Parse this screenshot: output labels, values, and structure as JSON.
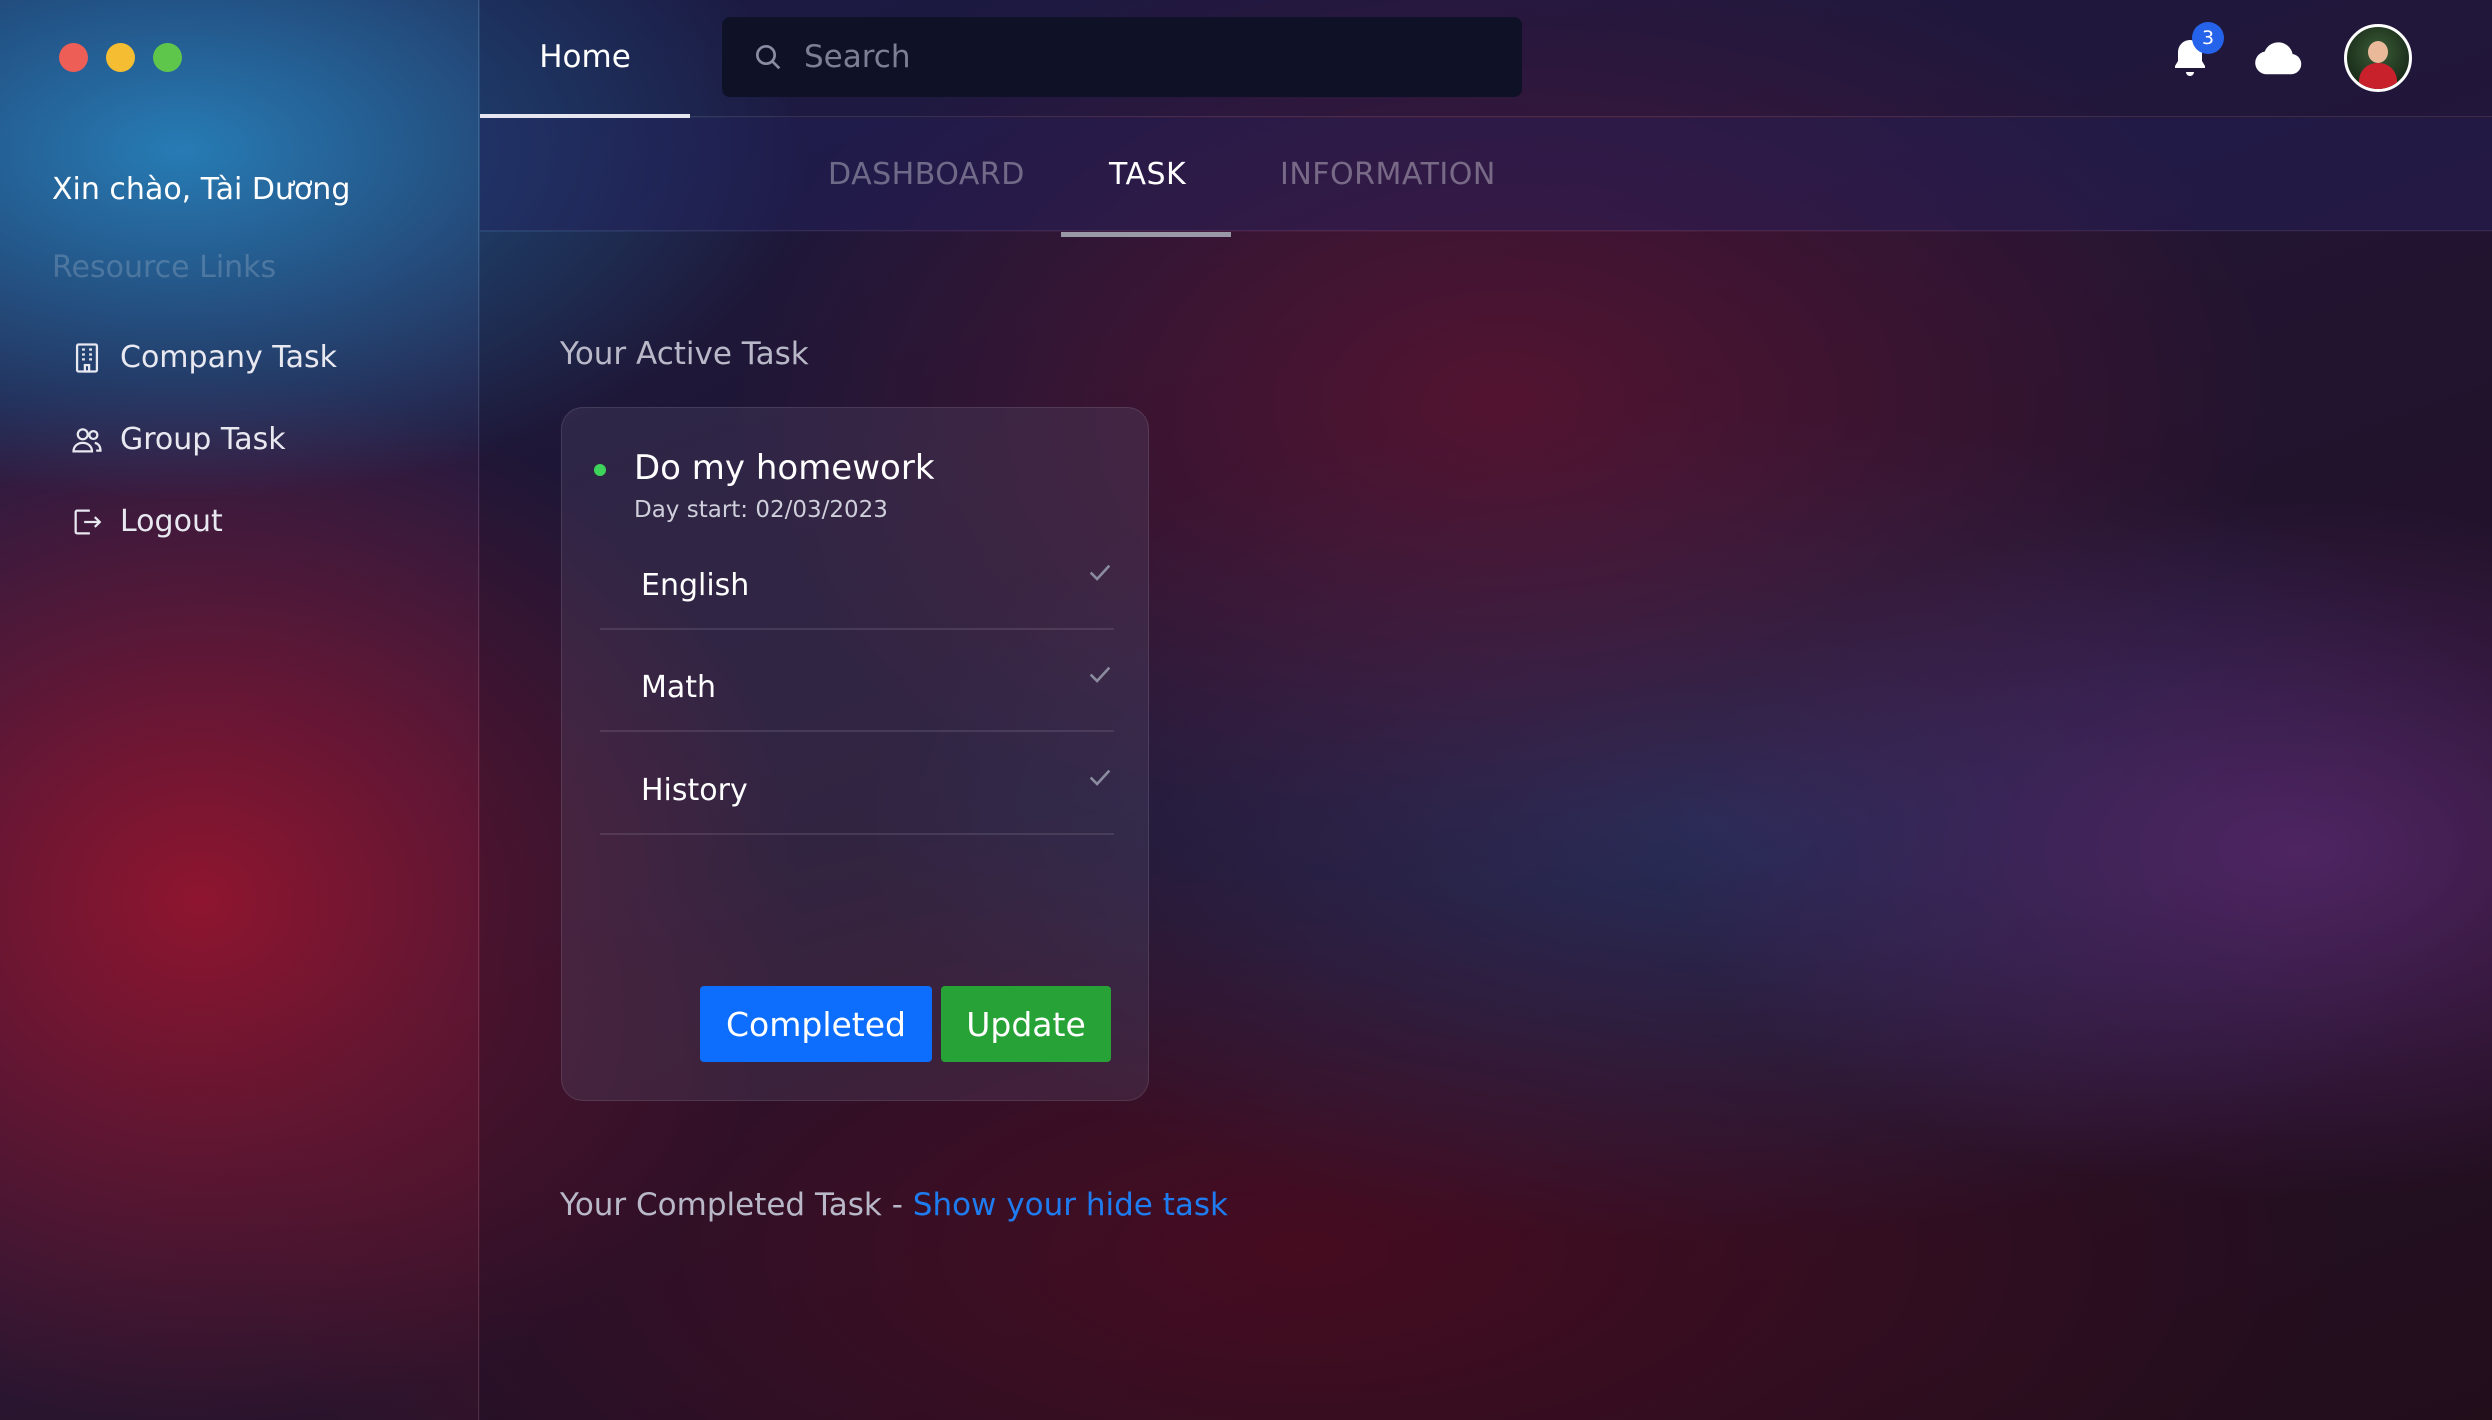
{
  "window": {
    "controls": [
      "close",
      "minimize",
      "zoom"
    ],
    "colors": {
      "close": "#ed5e57",
      "minimize": "#f5bd31",
      "zoom": "#5fc64c"
    }
  },
  "sidebar": {
    "greeting": "Xin chào, Tài Dương",
    "section_title": "Resource Links",
    "items": [
      {
        "label": "Company Task",
        "icon": "building-icon"
      },
      {
        "label": "Group Task",
        "icon": "users-icon"
      },
      {
        "label": "Logout",
        "icon": "logout-icon"
      }
    ]
  },
  "header": {
    "home_tab": "Home",
    "search": {
      "placeholder": "Search",
      "value": ""
    },
    "notifications": {
      "count": "3",
      "icon": "bell-icon",
      "badge_color": "#2563eb"
    },
    "cloud_icon": "cloud-icon",
    "avatar_icon": "user-avatar"
  },
  "subtabs": [
    {
      "label": "DASHBOARD",
      "active": false
    },
    {
      "label": "TASK",
      "active": true
    },
    {
      "label": "INFORMATION",
      "active": false
    }
  ],
  "main": {
    "active_section_title": "Your Active Task",
    "task": {
      "status_color": "#3ed35a",
      "title": "Do my homework",
      "day_start": "Day start: 02/03/2023",
      "subtasks": [
        {
          "label": "English",
          "icon": "check-icon"
        },
        {
          "label": "Math",
          "icon": "check-icon"
        },
        {
          "label": "History",
          "icon": "check-icon"
        }
      ],
      "buttons": {
        "completed": "Completed",
        "update": "Update"
      },
      "button_colors": {
        "completed": "#0d6efd",
        "update": "#27a236"
      }
    },
    "completed_section": {
      "text": "Your Completed Task - ",
      "link": "Show your hide task"
    }
  }
}
